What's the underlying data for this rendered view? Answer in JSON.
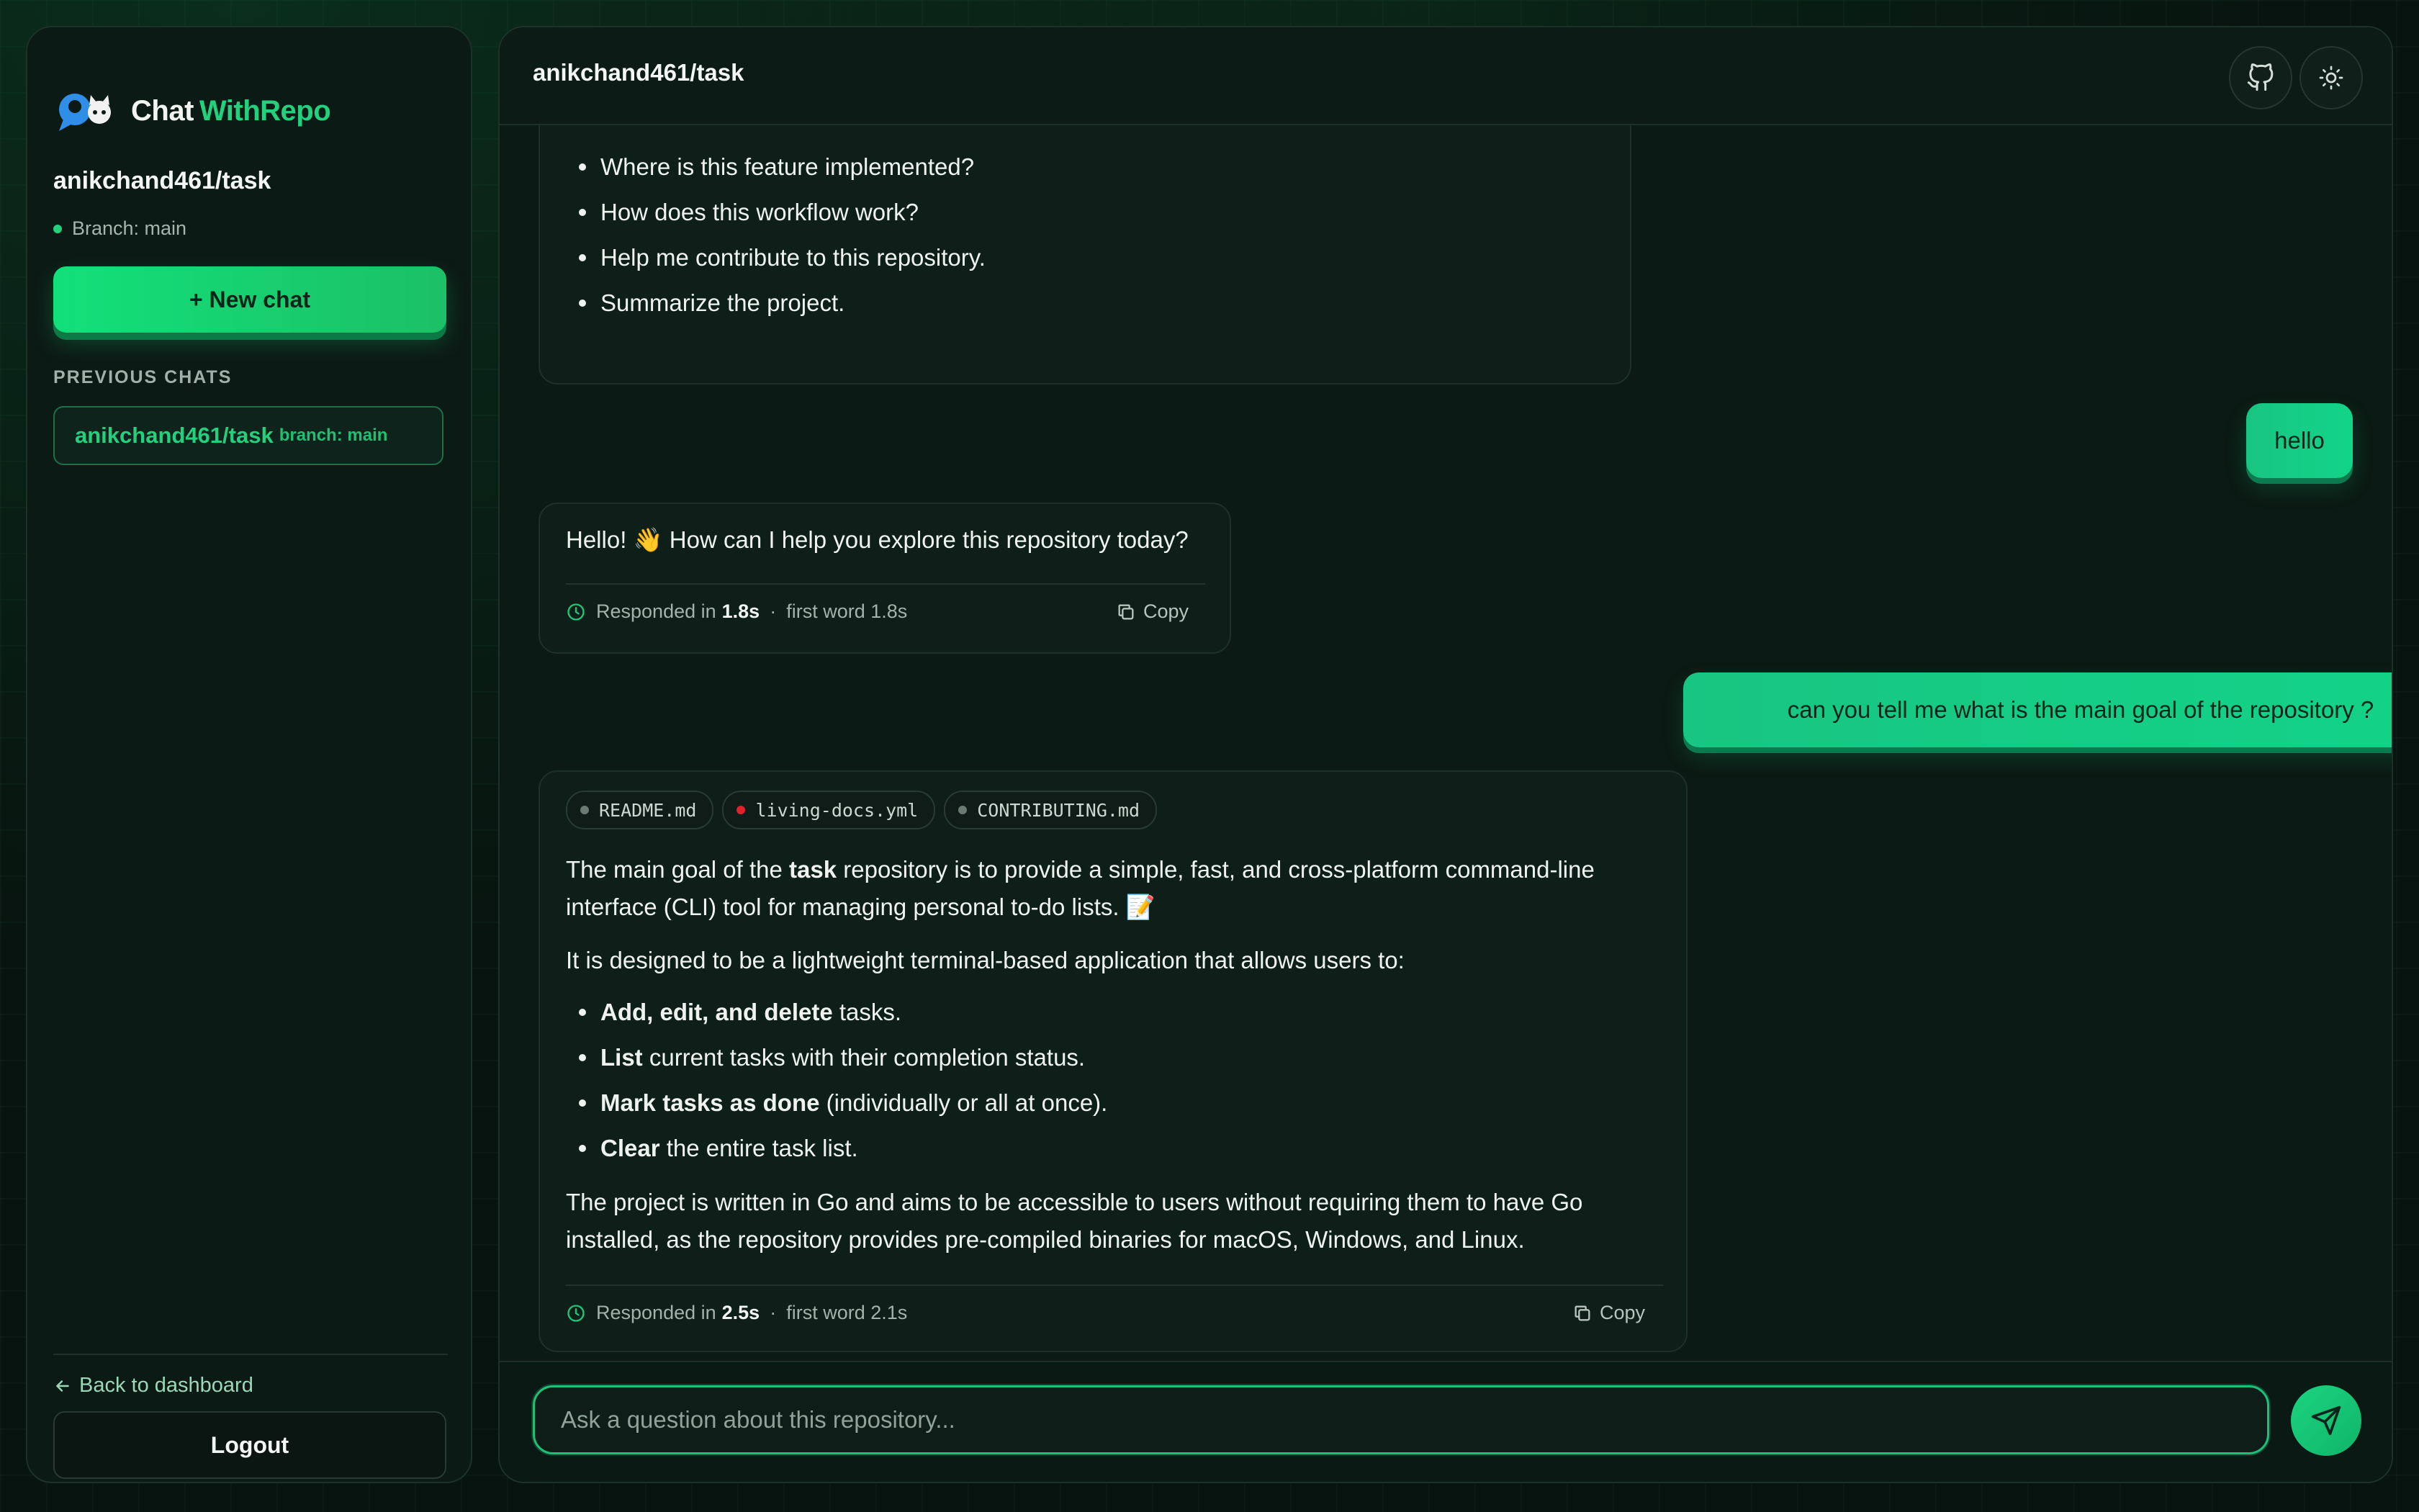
{
  "brand": {
    "word1": "Chat",
    "word2": "WithRepo"
  },
  "sidebar": {
    "repo_name": "anikchand461/task",
    "branch_label": "Branch: main",
    "new_chat_label": "+ New chat",
    "previous_chats_heading": "PREVIOUS CHATS",
    "previous_chats": [
      {
        "title": "anikchand461/task",
        "branch": "branch: main"
      }
    ],
    "back_label": "Back to dashboard",
    "logout_label": "Logout"
  },
  "header": {
    "title": "anikchand461/task"
  },
  "messages": {
    "intro_list": [
      "Where is this feature implemented?",
      "How does this workflow work?",
      "Help me contribute to this repository.",
      "Summarize the project."
    ],
    "user_1": "hello",
    "bot_1": {
      "text": "Hello! 👋 How can I help you explore this repository today?",
      "responded_prefix": "Responded in",
      "responded_time": "1.8s",
      "first_word": "first word 1.8s",
      "copy_label": "Copy"
    },
    "user_2": "can you tell me what is the main goal of the repository ?",
    "bot_2": {
      "sources": [
        {
          "name": "README.md",
          "dot_color": "#6b7a73"
        },
        {
          "name": "living-docs.yml",
          "dot_color": "#e0202a"
        },
        {
          "name": "CONTRIBUTING.md",
          "dot_color": "#6b7a73"
        }
      ],
      "p1_before": "The main goal of the ",
      "p1_bold": "task",
      "p1_after": " repository is to provide a simple, fast, and cross-platform command-line interface (CLI) tool for managing personal to-do lists. 📝",
      "p2": "It is designed to be a lightweight terminal-based application that allows users to:",
      "bullets": [
        {
          "bold": "Add, edit, and delete",
          "rest": " tasks."
        },
        {
          "bold": "List",
          "rest": " current tasks with their completion status."
        },
        {
          "bold": "Mark tasks as done",
          "rest": " (individually or all at once)."
        },
        {
          "bold": "Clear",
          "rest": " the entire task list."
        }
      ],
      "p3": "The project is written in Go and aims to be accessible to users without requiring them to have Go installed, as the repository provides pre-compiled binaries for macOS, Windows, and Linux.",
      "responded_prefix": "Responded in",
      "responded_time": "2.5s",
      "first_word": "first word 2.1s",
      "copy_label": "Copy"
    }
  },
  "composer": {
    "placeholder": "Ask a question about this repository..."
  },
  "colors": {
    "accent": "#22d07e",
    "background": "#08140f",
    "panel": "#0c1a15"
  },
  "icons": {
    "header_buttons": [
      "github-icon",
      "sun-icon"
    ],
    "send": "send-icon",
    "meta": "clock-icon",
    "copy": "copy-icon"
  }
}
